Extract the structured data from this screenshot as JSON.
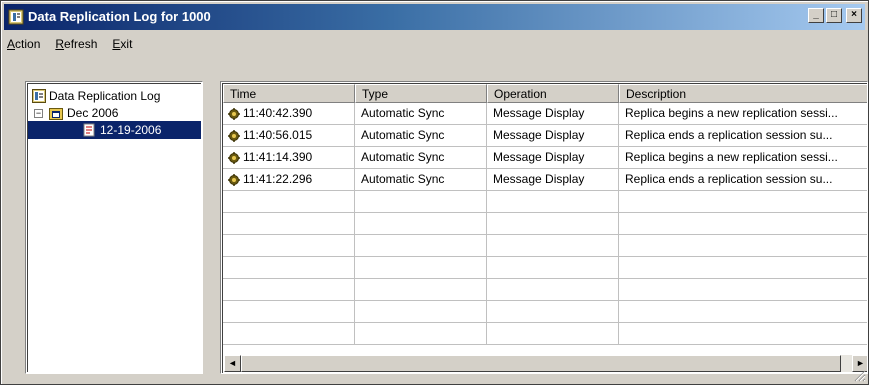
{
  "window": {
    "title": "Data Replication Log for 1000"
  },
  "caption_buttons": {
    "minimize": "_",
    "maximize": "□",
    "close": "×"
  },
  "menu": [
    {
      "label": "Action",
      "hotkey": "A",
      "rest": "ction"
    },
    {
      "label": "Refresh",
      "hotkey": "R",
      "rest": "efresh"
    },
    {
      "label": "Exit",
      "hotkey": "E",
      "rest": "xit"
    }
  ],
  "tree": {
    "root": "Data Replication Log",
    "month": "Dec 2006",
    "expander": "−",
    "day": "12-19-2006"
  },
  "table": {
    "columns": [
      "Time",
      "Type",
      "Operation",
      "Description"
    ],
    "rows": [
      {
        "time": "11:40:42.390",
        "type": "Automatic Sync",
        "operation": "Message Display",
        "description": "Replica begins a new replication sessi..."
      },
      {
        "time": "11:40:56.015",
        "type": "Automatic Sync",
        "operation": "Message Display",
        "description": "Replica ends a replication session su..."
      },
      {
        "time": "11:41:14.390",
        "type": "Automatic Sync",
        "operation": "Message Display",
        "description": "Replica begins a new replication sessi..."
      },
      {
        "time": "11:41:22.296",
        "type": "Automatic Sync",
        "operation": "Message Display",
        "description": "Replica ends a replication session su..."
      }
    ]
  },
  "scrollbar": {
    "left_arrow": "◄",
    "right_arrow": "►"
  },
  "colors": {
    "titlebar_start": "#0a246a",
    "titlebar_end": "#a6caf0",
    "selection": "#0a246a",
    "face": "#d4d0c8"
  }
}
